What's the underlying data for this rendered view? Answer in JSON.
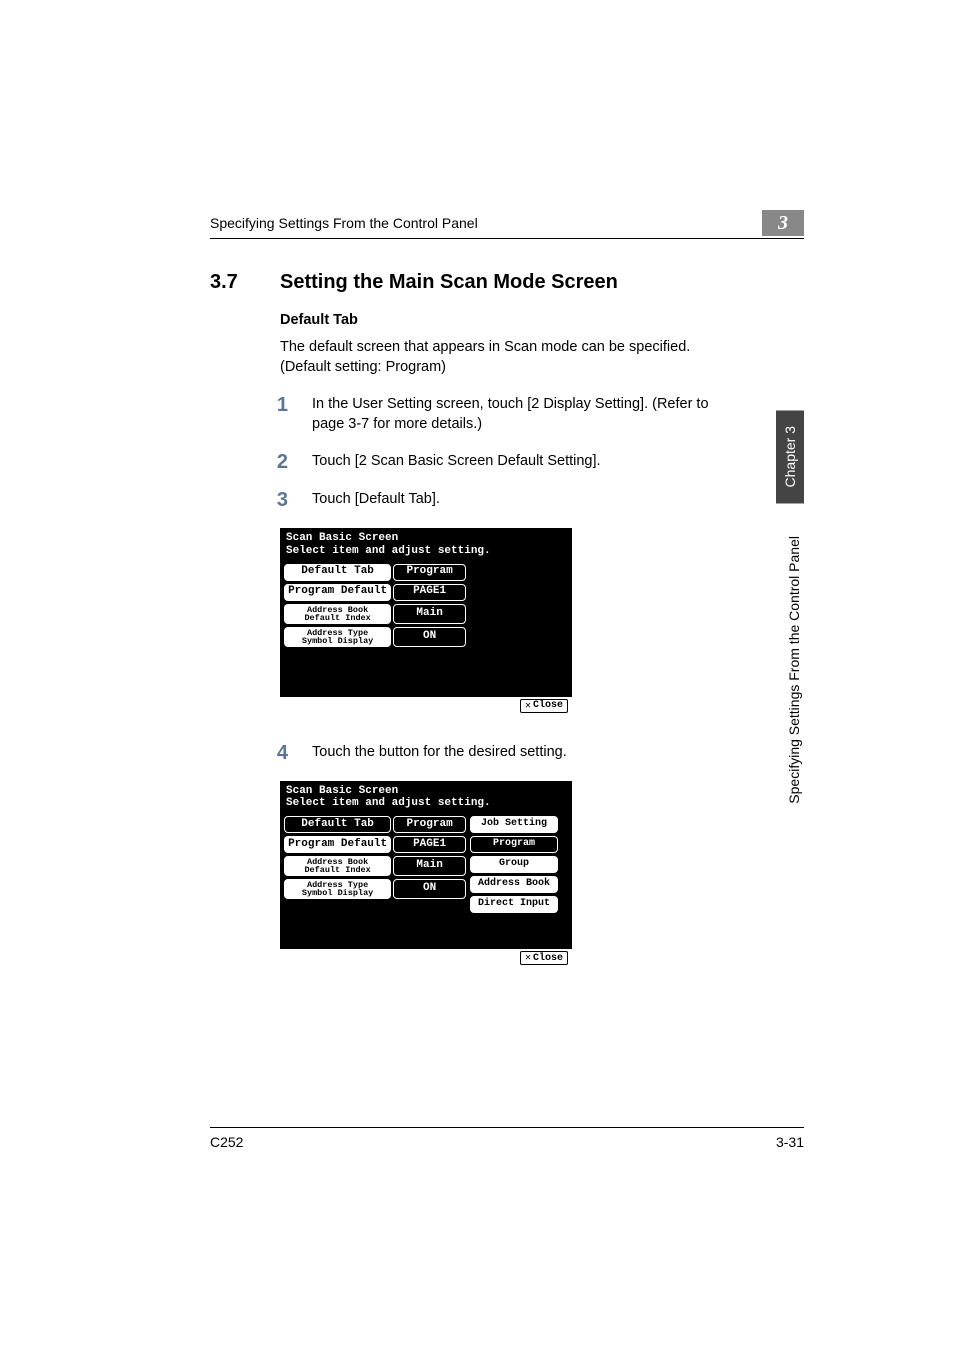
{
  "header": {
    "section_title": "Specifying Settings From the Control Panel",
    "chapter_number": "3"
  },
  "side": {
    "chapter_label": "Chapter 3",
    "section_label": "Specifying Settings From the Control Panel"
  },
  "heading": {
    "number": "3.7",
    "text": "Setting the Main Scan Mode Screen"
  },
  "subheading": "Default Tab",
  "intro": "The default screen that appears in Scan mode can be specified. (Default setting: Program)",
  "steps": [
    {
      "n": "1",
      "text": "In the User Setting screen, touch [2 Display Setting]. (Refer to page 3-7 for more details.)"
    },
    {
      "n": "2",
      "text": "Touch [2 Scan Basic Screen Default Setting]."
    },
    {
      "n": "3",
      "text": "Touch [Default Tab]."
    },
    {
      "n": "4",
      "text": "Touch the button for the desired setting."
    }
  ],
  "lcd": {
    "title_line1": "Scan Basic Screen",
    "title_line2": "Select item and adjust setting.",
    "rows": [
      {
        "label": "Default Tab",
        "value": "Program",
        "twoline": false,
        "selected_label": true
      },
      {
        "label": "Program Default",
        "value": "PAGE1",
        "twoline": false,
        "selected_label": false
      },
      {
        "label": "Address Book\nDefault Index",
        "value": "Main",
        "twoline": true,
        "selected_label": false
      },
      {
        "label": "Address Type\nSymbol Display",
        "value": "ON",
        "twoline": true,
        "selected_label": false
      }
    ],
    "close": "Close"
  },
  "lcd2": {
    "side_title": "Job Setting",
    "side_items": [
      "Program",
      "Group",
      "Address Book",
      "Direct Input"
    ]
  },
  "footer": {
    "model": "C252",
    "page": "3-31"
  }
}
